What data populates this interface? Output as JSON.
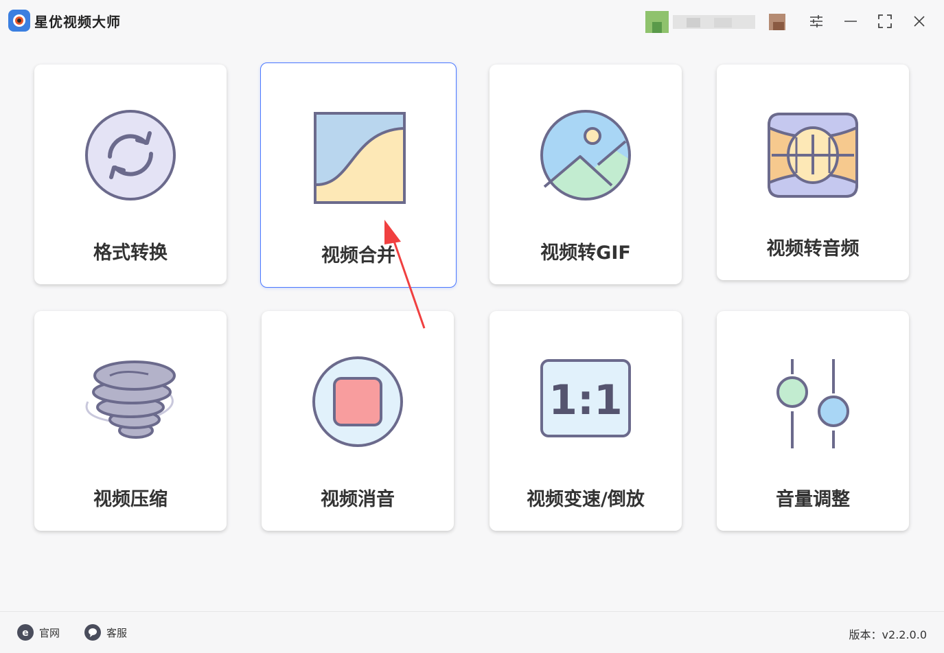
{
  "app": {
    "title": "星优视频大师",
    "accent": "#4b78ff",
    "icon_stroke": "#6b6a8c"
  },
  "window_controls": [
    {
      "name": "settings-icon"
    },
    {
      "name": "minimize-icon"
    },
    {
      "name": "maximize-icon"
    },
    {
      "name": "close-icon"
    }
  ],
  "tools": [
    {
      "label": "格式转换",
      "icon": "convert-arrows-icon"
    },
    {
      "label": "视频合并",
      "icon": "merge-curve-icon",
      "selected": true
    },
    {
      "label": "视频转GIF",
      "icon": "picture-landscape-icon"
    },
    {
      "label": "视频转音频",
      "icon": "audio-grid-icon"
    },
    {
      "label": "视频压缩",
      "icon": "tornado-compress-icon"
    },
    {
      "label": "视频消音",
      "icon": "stop-square-icon"
    },
    {
      "label": "视频变速/倒放",
      "icon": "ratio-1-1-icon",
      "ratio_text": "1:1"
    },
    {
      "label": "音量调整",
      "icon": "volume-sliders-icon"
    }
  ],
  "footer": {
    "website_label": "官网",
    "support_label": "客服",
    "version": "版本：v2.2.0.0"
  }
}
